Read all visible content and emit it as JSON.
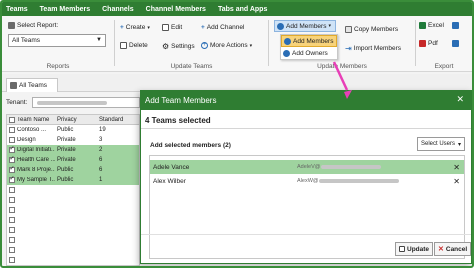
{
  "menubar": {
    "items": [
      "Teams",
      "Team Members",
      "Channels",
      "Channel Members",
      "Tabs and Apps"
    ]
  },
  "ribbon": {
    "reports": {
      "select_label": "Select Report:",
      "select_value": "All Teams",
      "group_label": "Reports"
    },
    "update_teams": {
      "create_label": "Create",
      "edit_label": "Edit",
      "add_channel_label": "Add Channel",
      "delete_label": "Delete",
      "settings_label": "Settings",
      "more_actions_label": "More Actions",
      "group_label": "Update Teams"
    },
    "update_members": {
      "add_members_label": "Add Members",
      "copy_members_label": "Copy Members",
      "import_members_label": "Import Members",
      "group_label": "Update Members",
      "dropdown": [
        "Add Members",
        "Add Owners"
      ]
    },
    "export": {
      "excel_label": "Excel",
      "pdf_label": "Pdf",
      "group_label": "Export"
    }
  },
  "tabstrip": {
    "tab_label": "All Teams"
  },
  "left_panel": {
    "tenant_label": "Tenant:",
    "columns": [
      "Team Name",
      "Privacy",
      "Standard"
    ],
    "rows": [
      {
        "name": "Contoso ...",
        "privacy": "Public",
        "standard": "19",
        "checked": false,
        "selected": false
      },
      {
        "name": "Design",
        "privacy": "Private",
        "standard": "3",
        "checked": false,
        "selected": false
      },
      {
        "name": "Digital Initiati...",
        "privacy": "Private",
        "standard": "2",
        "checked": true,
        "selected": true
      },
      {
        "name": "Health Care ...",
        "privacy": "Private",
        "standard": "6",
        "checked": true,
        "selected": true
      },
      {
        "name": "Mark 8 Proje...",
        "privacy": "Public",
        "standard": "6",
        "checked": true,
        "selected": true
      },
      {
        "name": "My Sample T...",
        "privacy": "Public",
        "standard": "1",
        "checked": true,
        "selected": true
      },
      {
        "name": "",
        "privacy": "",
        "standard": "",
        "checked": false,
        "selected": false
      },
      {
        "name": "",
        "privacy": "",
        "standard": "",
        "checked": false,
        "selected": false
      },
      {
        "name": "",
        "privacy": "",
        "standard": "",
        "checked": false,
        "selected": false
      },
      {
        "name": "",
        "privacy": "",
        "standard": "",
        "checked": false,
        "selected": false
      },
      {
        "name": "",
        "privacy": "",
        "standard": "",
        "checked": false,
        "selected": false
      },
      {
        "name": "",
        "privacy": "",
        "standard": "",
        "checked": false,
        "selected": false
      },
      {
        "name": "",
        "privacy": "",
        "standard": "",
        "checked": false,
        "selected": false
      },
      {
        "name": "",
        "privacy": "",
        "standard": "",
        "checked": false,
        "selected": false
      }
    ]
  },
  "dialog": {
    "title": "Add Team Members",
    "teams_selected": "4 Teams selected",
    "add_selected_label": "Add selected members (2)",
    "select_users_label": "Select Users",
    "members": [
      {
        "name": "Adele Vance",
        "email_prefix": "AdeleV@",
        "selected": true
      },
      {
        "name": "Alex Wilber",
        "email_prefix": "AlexW@",
        "selected": false
      }
    ],
    "update_label": "Update",
    "cancel_label": "Cancel"
  },
  "colors": {
    "menubar": "#2f7d32",
    "selection": "#9fd39f",
    "highlight": "#f8d37a",
    "arrow": "#e83fb7"
  }
}
